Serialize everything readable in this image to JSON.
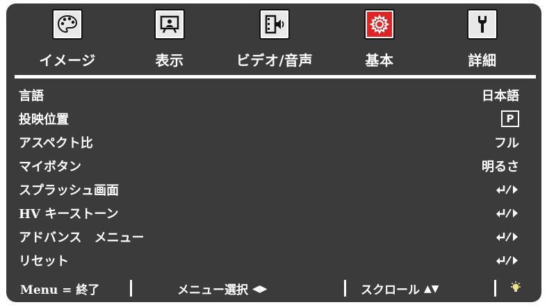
{
  "tabs": [
    {
      "label": "イメージ",
      "icon": "palette-icon",
      "active": false
    },
    {
      "label": "表示",
      "icon": "display-screen-icon",
      "active": false
    },
    {
      "label": "ビデオ/音声",
      "icon": "video-audio-icon",
      "active": false
    },
    {
      "label": "基本",
      "icon": "gear-icon",
      "active": true
    },
    {
      "label": "詳細",
      "icon": "wrench-icon",
      "active": false
    }
  ],
  "menu": {
    "items": [
      {
        "label": "言語",
        "value": "日本語"
      },
      {
        "label": "投映位置",
        "value": "P"
      },
      {
        "label": "アスペクト比",
        "value": "フル"
      },
      {
        "label": "マイボタン",
        "value": "明るさ"
      },
      {
        "label": "スプラッシュ画面",
        "value": ""
      },
      {
        "label": "HV キーストーン",
        "value": ""
      },
      {
        "label": "アドバンス　メニュー",
        "value": ""
      },
      {
        "label": "リセット",
        "value": ""
      }
    ]
  },
  "footer": {
    "exit": "Menu = 終了",
    "select": "メニュー選択",
    "select_glyph": "◀▶",
    "scroll": "スクロール",
    "scroll_glyph": "▲▼"
  },
  "colors": {
    "background": "#3b3b3b",
    "text": "#ffffff",
    "active_tab": "#e02323",
    "icon_bg": "#e8e8e8"
  }
}
